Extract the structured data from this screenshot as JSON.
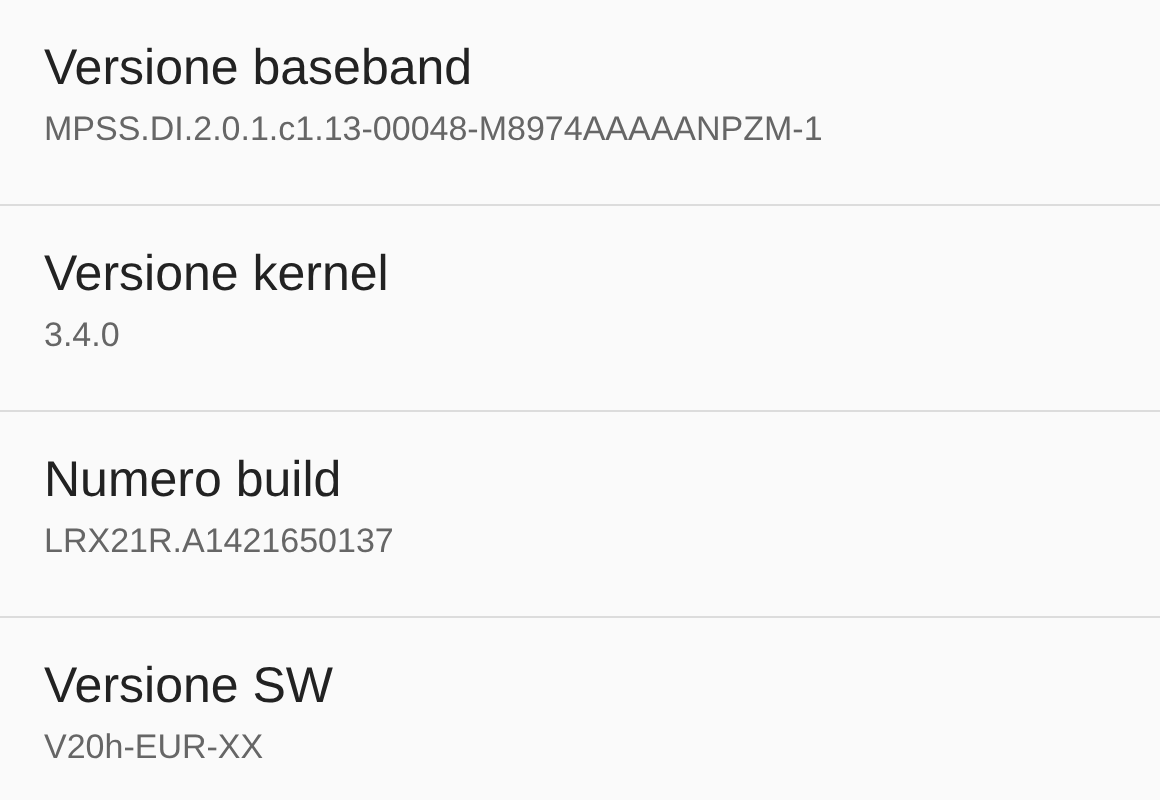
{
  "items": [
    {
      "title": "Versione baseband",
      "value": "MPSS.DI.2.0.1.c1.13-00048-M8974AAAAANPZM-1"
    },
    {
      "title": "Versione kernel",
      "value": "3.4.0"
    },
    {
      "title": "Numero build",
      "value": "LRX21R.A1421650137"
    },
    {
      "title": "Versione SW",
      "value": "V20h-EUR-XX"
    }
  ]
}
